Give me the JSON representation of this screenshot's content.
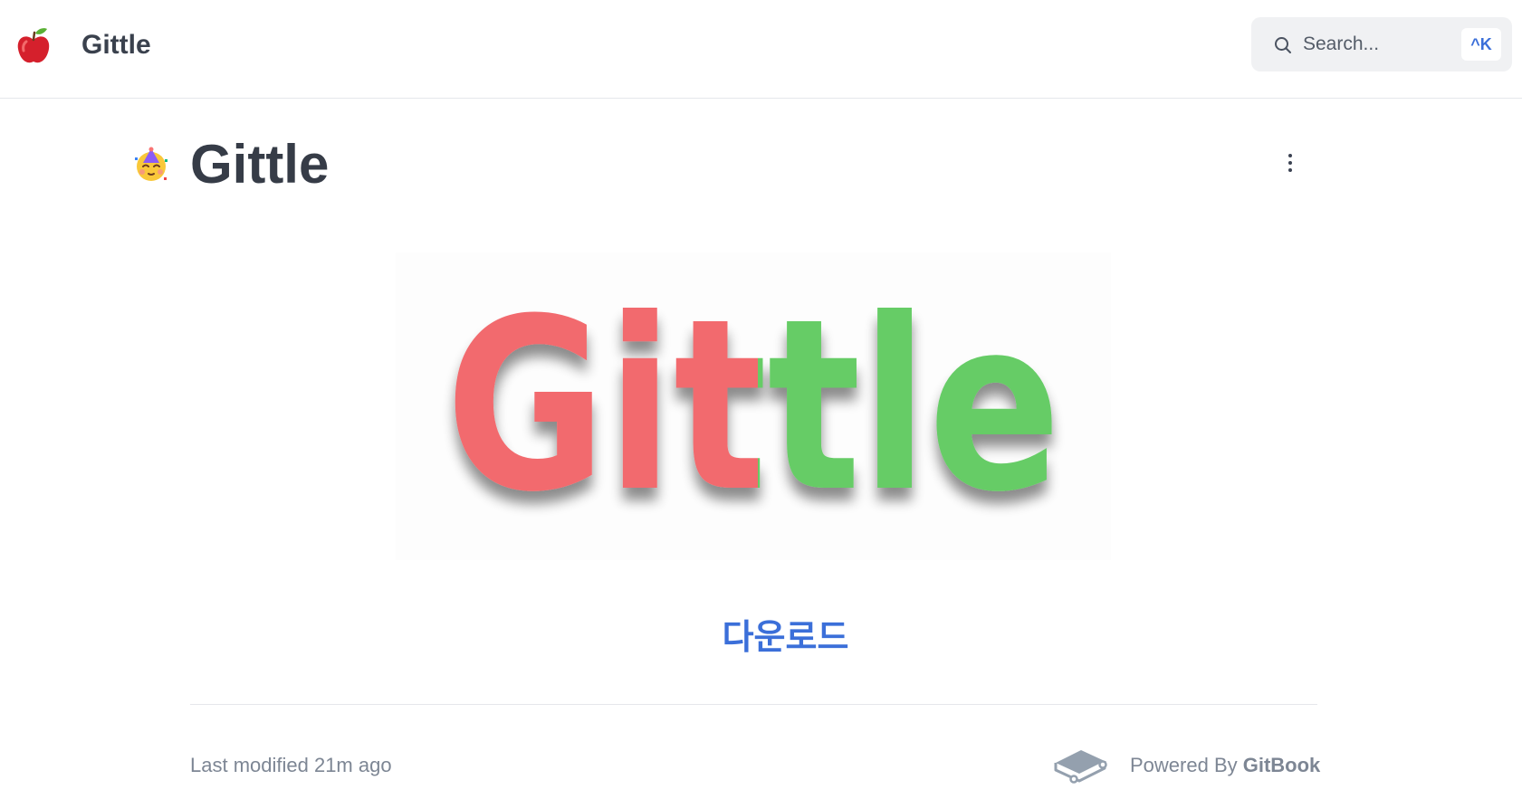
{
  "header": {
    "logo_icon": "apple-icon",
    "site_title": "Gittle",
    "search": {
      "placeholder": "Search...",
      "shortcut": "^K",
      "icon": "search-icon"
    }
  },
  "page": {
    "emoji_icon": "partying-face-icon",
    "title": "Gittle",
    "more_icon": "more-vertical-icon"
  },
  "hero": {
    "logo_text": "Gittle",
    "colors": {
      "left": "#f26b6e",
      "right": "#66cc66"
    }
  },
  "download": {
    "label": "다운로드",
    "color": "#3b6fd9"
  },
  "footer": {
    "last_modified": "Last modified 21m ago",
    "powered_prefix": "Powered By ",
    "powered_brand": "GitBook",
    "brand_icon": "gitbook-icon"
  }
}
